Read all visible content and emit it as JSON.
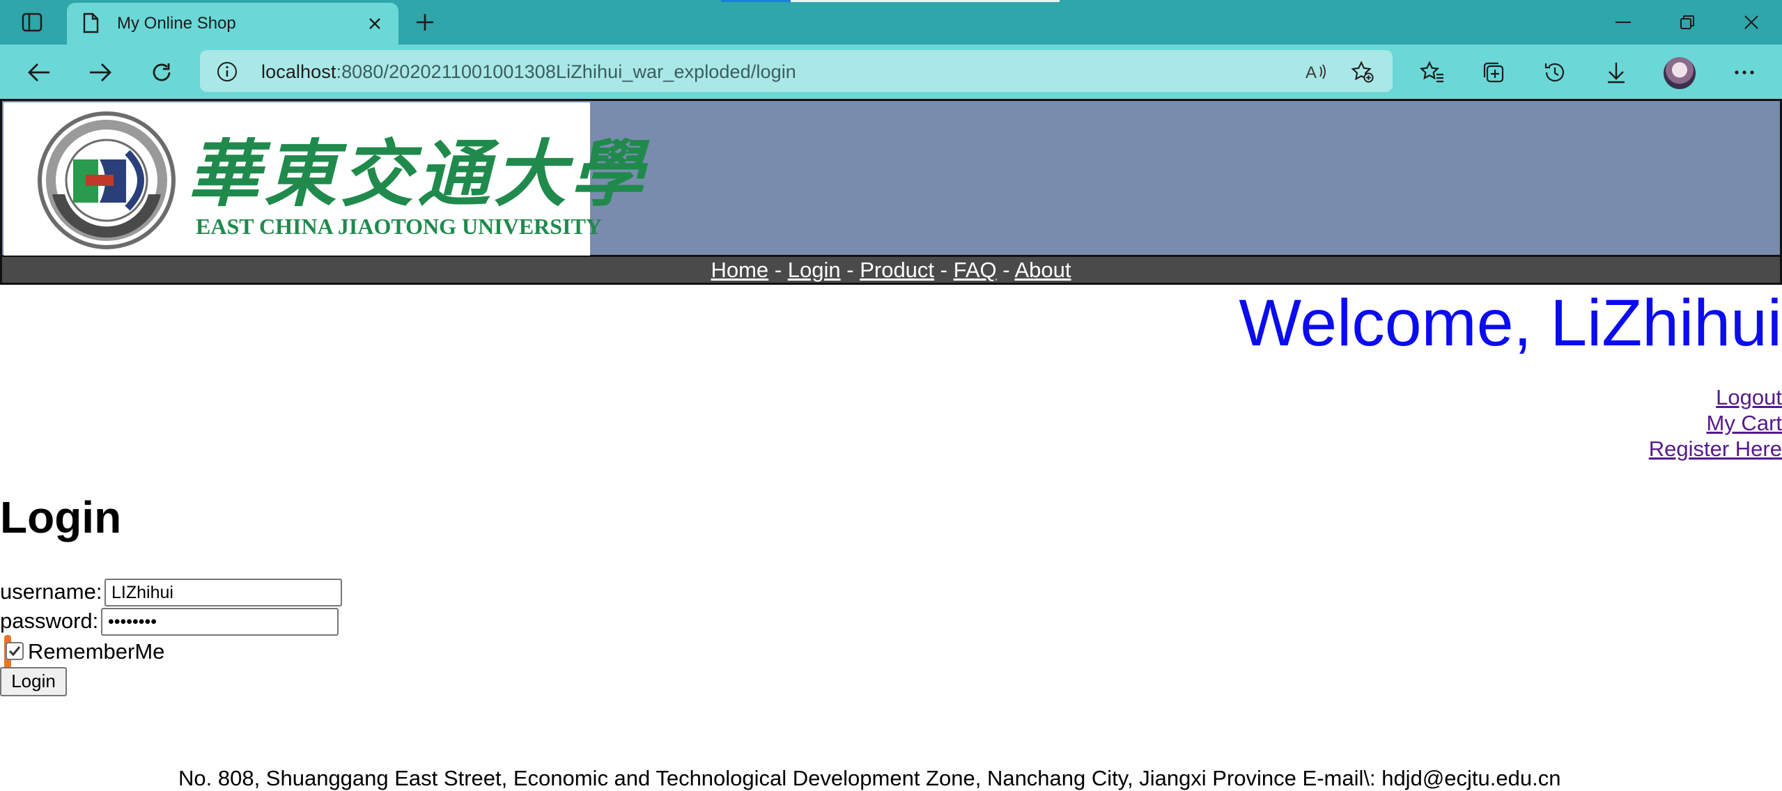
{
  "browser": {
    "tab_title": "My Online Shop",
    "url_host": "localhost",
    "url_rest": ":8080/2020211001001308LiZhihui_war_exploded/login"
  },
  "site": {
    "logo_text_cn": "華東交通大學",
    "logo_text_en": "EAST CHINA JIAOTONG UNIVERSITY",
    "nav": {
      "home": "Home",
      "login": "Login",
      "product": "Product",
      "faq": "FAQ",
      "about": "About",
      "sep": "-"
    },
    "welcome": "Welcome, LiZhihui",
    "links": {
      "logout": "Logout",
      "my_cart": "My Cart",
      "register": "Register Here"
    }
  },
  "login_form": {
    "heading": "Login",
    "username_label": "username:",
    "username_value": "LIZhihui",
    "password_label": "password:",
    "password_value": "••••••••",
    "remember_label": "RememberMe",
    "remember_checked": true,
    "submit_label": "Login"
  },
  "footer": {
    "text": "No. 808, Shuanggang East Street, Economic and Technological Development Zone, Nanchang City, Jiangxi Province E-mail\\: hdjd@ecjtu.edu.cn"
  },
  "colors": {
    "tab_bar": "#2ea6aa",
    "toolbar": "#6cd7d7",
    "banner": "#7a8cad",
    "logo_green": "#1f8a4c",
    "welcome": "#0b0bf0",
    "visited_link": "#551a8b"
  }
}
